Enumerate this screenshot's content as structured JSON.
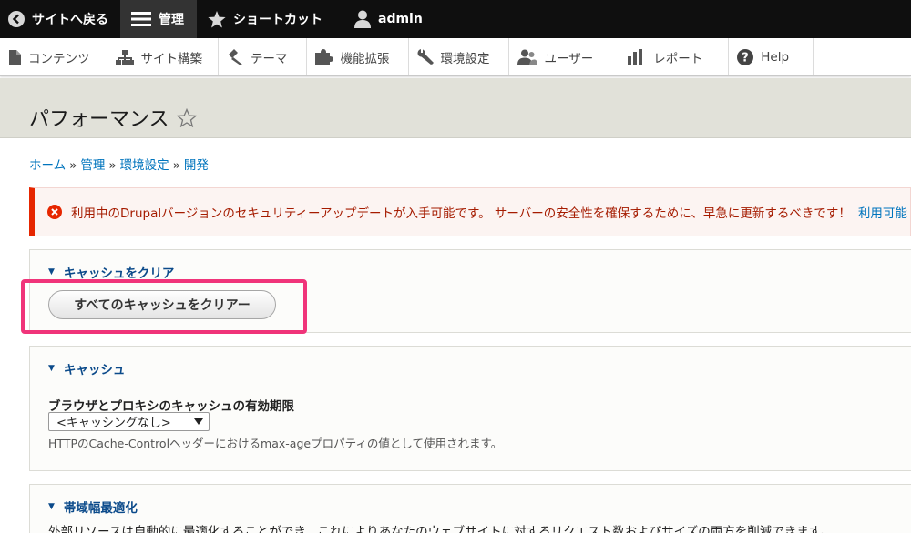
{
  "toolbar": {
    "back_label": "サイトへ戻る",
    "manage_label": "管理",
    "shortcuts_label": "ショートカット",
    "user_label": "admin"
  },
  "tray": {
    "items": [
      {
        "label": "コンテンツ",
        "icon": "file-icon"
      },
      {
        "label": "サイト構築",
        "icon": "sitemap-icon"
      },
      {
        "label": "テーマ",
        "icon": "paintbrush-icon"
      },
      {
        "label": "機能拡張",
        "icon": "puzzle-icon"
      },
      {
        "label": "環境設定",
        "icon": "wrench-icon"
      },
      {
        "label": "ユーザー",
        "icon": "users-icon"
      },
      {
        "label": "レポート",
        "icon": "bar-chart-icon"
      },
      {
        "label": "Help",
        "icon": "help-icon"
      }
    ]
  },
  "page": {
    "title": "パフォーマンス"
  },
  "breadcrumb": {
    "items": [
      "ホーム",
      "管理",
      "環境設定",
      "開発"
    ],
    "separator": "»"
  },
  "error": {
    "text": "利用中のDrupalバージョンのセキュリティーアップデートが入手可能です。 サーバーの安全性を確保するために、早急に更新するべきです！",
    "link": "利用可能"
  },
  "clear_cache": {
    "legend": "キャッシュをクリア",
    "button_label": "すべてのキャッシュをクリアー"
  },
  "caching": {
    "legend": "キャッシュ",
    "max_age_label": "ブラウザとプロキシのキャッシュの有効期限",
    "max_age_selected": "<キャッシングなし>",
    "max_age_description": "HTTPのCache-Controlヘッダーにおけるmax-ageプロパティの値として使用されます。"
  },
  "bandwidth": {
    "legend": "帯域幅最適化",
    "description": "外部リソースは自動的に最適化することができ、これによりあなたのウェブサイトに対するリクエスト数およびサイズの両方を削減できます。"
  },
  "colors": {
    "toolbar_bg": "#0f0f0f",
    "link": "#0074bd",
    "error_border": "#e62600",
    "highlight": "#f0347a"
  }
}
